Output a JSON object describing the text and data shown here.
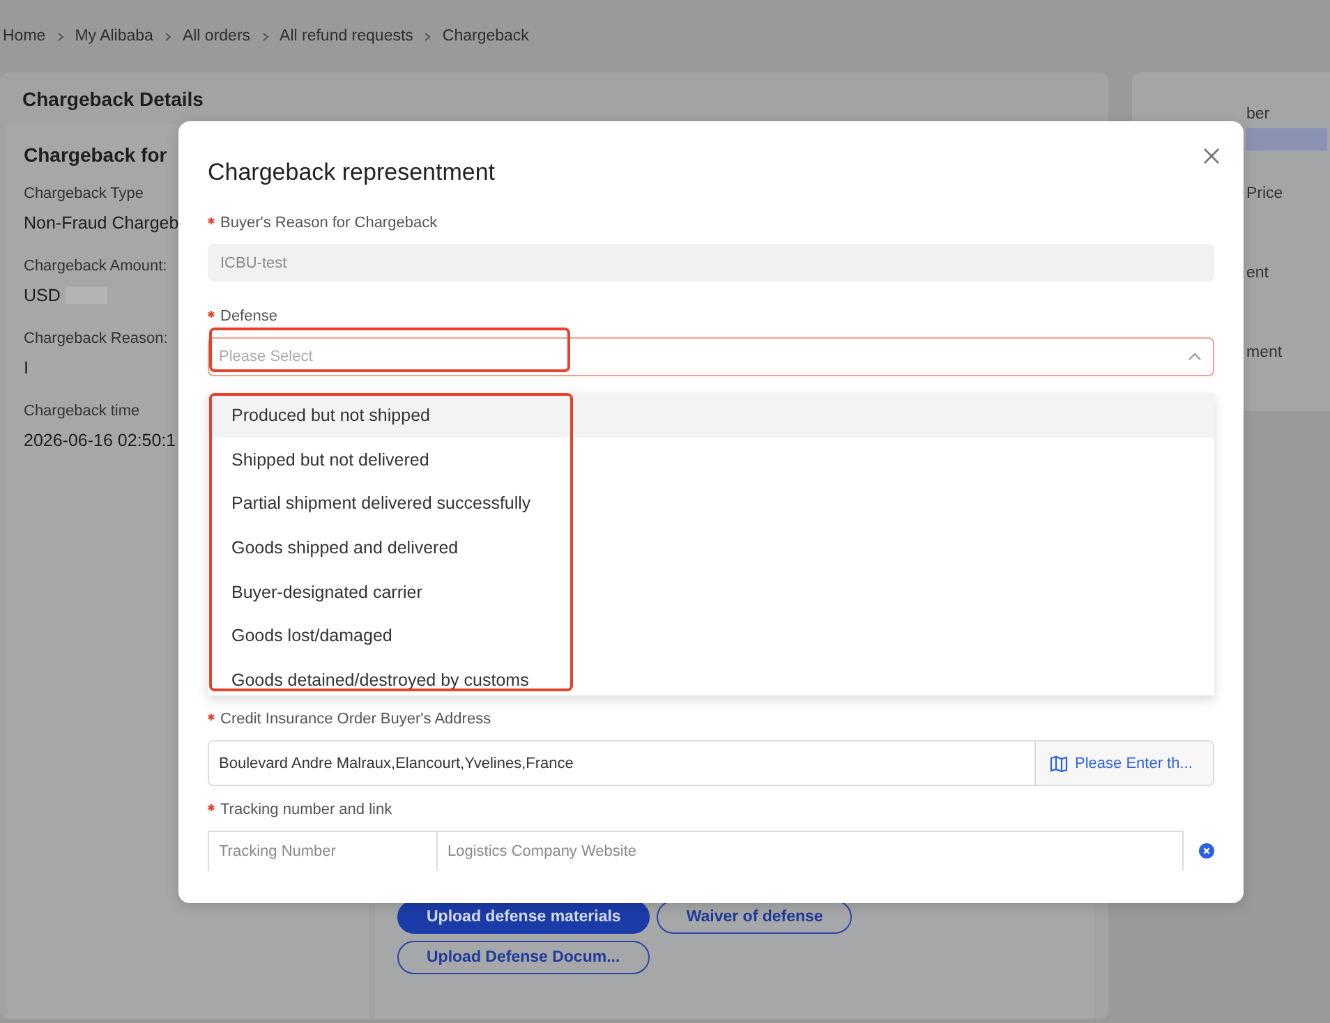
{
  "breadcrumb": [
    "Home",
    "My Alibaba",
    "All orders",
    "All refund requests",
    "Chargeback"
  ],
  "details": {
    "title": "Chargeback Details",
    "section_title": "Chargeback for",
    "fields": [
      {
        "label": "Chargeback Type",
        "value": "Non-Fraud Chargeb"
      },
      {
        "label": "Chargeback Amount:",
        "value": "USD"
      },
      {
        "label": "Chargeback Reason:",
        "value": "I"
      },
      {
        "label": "Chargeback time",
        "value": "2026-06-16 02:50:1"
      }
    ]
  },
  "side_panel": {
    "labels": [
      "ber",
      "Price",
      "ent",
      "ment"
    ]
  },
  "actions": [
    {
      "label": "Upload defense materials",
      "kind": "primary"
    },
    {
      "label": "Waiver of defense",
      "kind": "outline"
    },
    {
      "label": "Upload Defense Docum...",
      "kind": "outline"
    }
  ],
  "modal": {
    "title": "Chargeback representment",
    "reason": {
      "label": "Buyer's Reason for Chargeback",
      "required": true,
      "value": "ICBU-test",
      "disabled": true
    },
    "defense": {
      "label": "Defense",
      "required": true,
      "placeholder": "Please Select",
      "expanded": true,
      "options": [
        {
          "label": "Produced but not shipped",
          "highlighted": true
        },
        {
          "label": "Shipped but not delivered",
          "highlighted": false
        },
        {
          "label": "Partial shipment delivered successfully",
          "highlighted": false
        },
        {
          "label": "Goods shipped and delivered",
          "highlighted": false
        },
        {
          "label": "Buyer-designated carrier",
          "highlighted": false
        },
        {
          "label": "Goods lost/damaged",
          "highlighted": false
        },
        {
          "label": "Goods detained/destroyed by customs",
          "highlighted": false
        }
      ]
    },
    "address": {
      "label": "Credit Insurance Order Buyer's Address",
      "required": true,
      "value": "Boulevard Andre Malraux,Elancourt,Yvelines,France",
      "addon": "Please Enter th..."
    },
    "tracking": {
      "label": "Tracking number and link",
      "required": true,
      "placeholders": [
        "Tracking Number",
        "Logistics Company Website"
      ]
    }
  }
}
